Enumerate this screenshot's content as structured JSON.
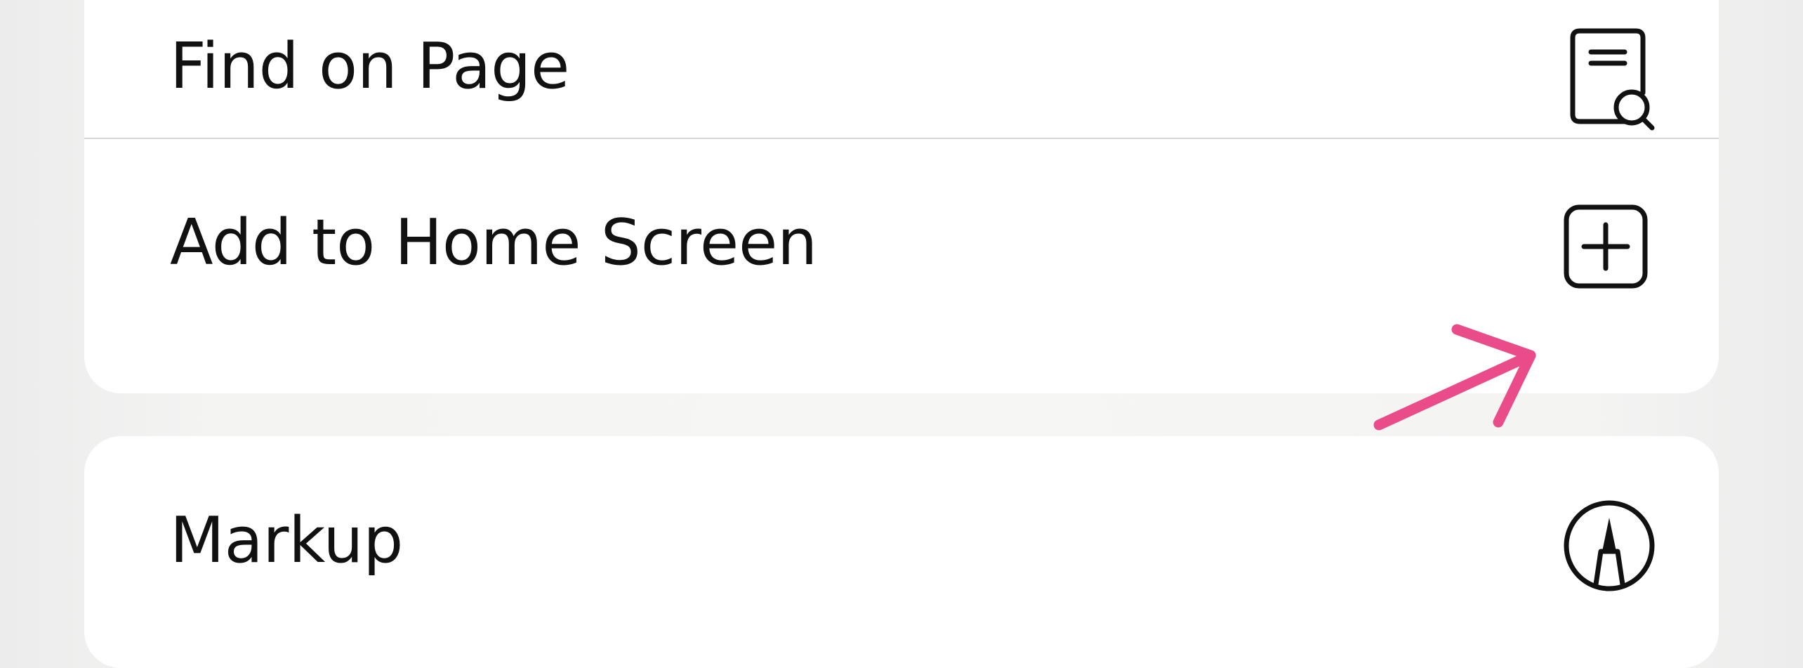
{
  "menu": {
    "items": [
      {
        "label": "Find on Page",
        "icon": "document-magnifying-glass-icon"
      },
      {
        "label": "Add to Home Screen",
        "icon": "plus-square-icon"
      },
      {
        "label": "Markup",
        "icon": "markup-pen-icon"
      }
    ]
  },
  "annotation": {
    "arrow_color": "#ea4c89",
    "points_to": "Add to Home Screen"
  },
  "colors": {
    "background": "#f6f6f4",
    "card": "#ffffff",
    "text": "#111111",
    "divider": "#d7d7d7"
  }
}
